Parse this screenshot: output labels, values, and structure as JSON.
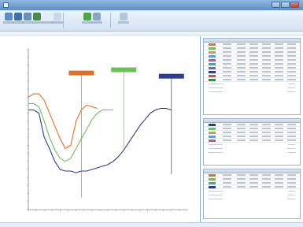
{
  "window": {
    "title": ""
  },
  "ribbon": {
    "buttons": [
      {
        "icon": "open-icon",
        "color": "#5b8ec7"
      },
      {
        "icon": "save-icon",
        "color": "#3d6fb0"
      },
      {
        "icon": "print-icon",
        "color": "#6a8fb8"
      },
      {
        "icon": "export-icon",
        "color": "#4a8c4a"
      },
      {
        "icon": "document-icon",
        "color": "#e3edf7"
      },
      {
        "icon": "settings-icon",
        "color": "#c9d7e6"
      },
      {
        "icon": "play-icon",
        "color": "#48a848"
      },
      {
        "icon": "zoom-icon",
        "color": "#8aa6c4"
      },
      {
        "icon": "grid-icon",
        "color": "#b3c6da"
      }
    ]
  },
  "chart": {
    "title": "",
    "ylabel": "",
    "xlabel": "",
    "annotations": [
      {
        "color": "#e07028",
        "label": ""
      },
      {
        "color": "#6cbf5a",
        "label": ""
      },
      {
        "color": "#2a3f8f",
        "label": ""
      }
    ]
  },
  "chart_data": {
    "type": "line",
    "title": "",
    "xlabel": "",
    "ylabel": "",
    "x": [
      0,
      1,
      2,
      3,
      4,
      5,
      6,
      7,
      8,
      9,
      10,
      11,
      12,
      13,
      14,
      15,
      16,
      17,
      18,
      19,
      20,
      21,
      22,
      23,
      24,
      25,
      26,
      27,
      28,
      29,
      30
    ],
    "series": [
      {
        "color": "#2a3f8f",
        "values": [
          62,
          62,
          60,
          45,
          38,
          30,
          25,
          24,
          24,
          23,
          24,
          24,
          25,
          26,
          27,
          28,
          30,
          33,
          37,
          42,
          47,
          52,
          56,
          60,
          62,
          63,
          63,
          62,
          null,
          null,
          null
        ]
      },
      {
        "color": "#e07028",
        "values": [
          70,
          72,
          72,
          68,
          60,
          52,
          44,
          38,
          40,
          55,
          62,
          65,
          64,
          63,
          null,
          null,
          null,
          null,
          null,
          null,
          null,
          null,
          null,
          null,
          null,
          null,
          null,
          null,
          null,
          null,
          null
        ]
      },
      {
        "color": "#6cbf5a",
        "values": [
          66,
          66,
          64,
          55,
          45,
          37,
          32,
          30,
          32,
          38,
          44,
          50,
          56,
          60,
          62,
          62,
          62,
          null,
          null,
          null,
          null,
          null,
          null,
          null,
          null,
          null,
          null,
          null,
          null,
          null,
          null
        ]
      }
    ],
    "ylim": [
      0,
      100
    ],
    "grid": false
  },
  "panel": {
    "section1_rows": [
      {
        "color": "#e07028"
      },
      {
        "color": "#6cbf5a"
      },
      {
        "color": "#c8a23c"
      },
      {
        "color": "#5aa0d8"
      },
      {
        "color": "#d04ea0"
      },
      {
        "color": "#47a6a0"
      },
      {
        "color": "#8a5bc2"
      },
      {
        "color": "#2a3f8f"
      },
      {
        "color": "#e04848"
      },
      {
        "color": "#3c8a3c"
      }
    ],
    "section2_rows": [
      {
        "color": "#2a3f8f"
      },
      {
        "color": "#6cbf5a"
      },
      {
        "color": "#c8a23c"
      },
      {
        "color": "#5aa0d8"
      },
      {
        "color": "#d04ea0"
      }
    ],
    "section3_rows": [
      {
        "color": "#e07028"
      },
      {
        "color": "#6cbf5a"
      },
      {
        "color": "#47a6a0"
      },
      {
        "color": "#2a3f8f"
      }
    ]
  }
}
